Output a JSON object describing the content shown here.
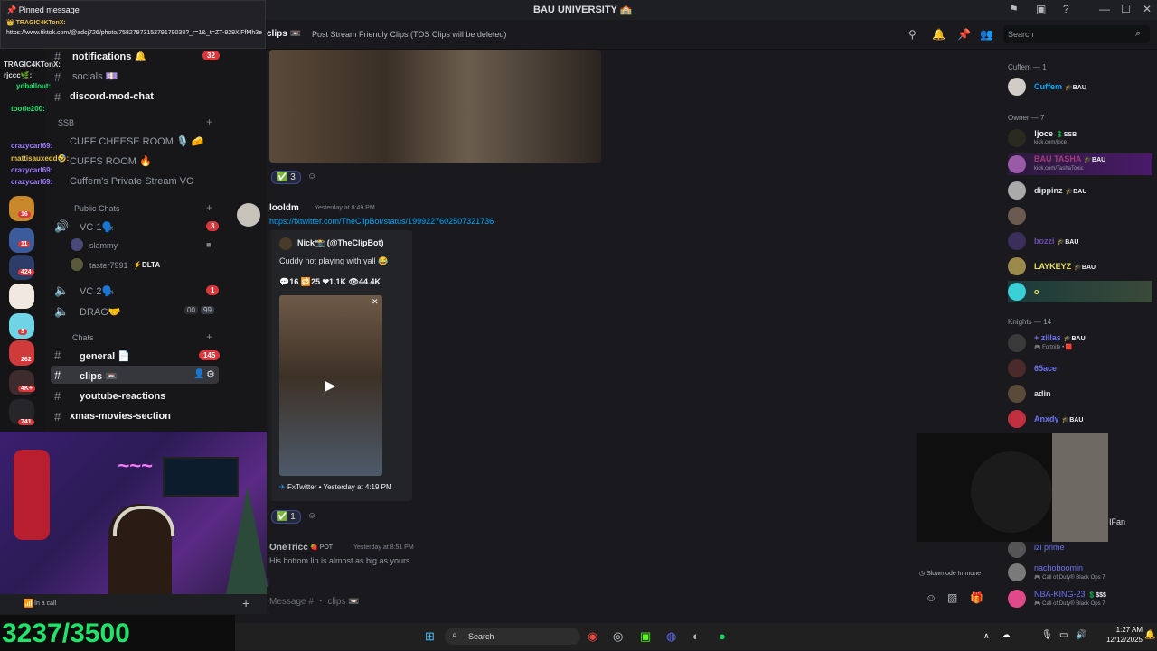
{
  "titlebar": {
    "title": "BAU UNIVERSITY 🏫"
  },
  "pinned": {
    "header": "📌 Pinned message",
    "author": "👑 TRAGIC4KTonX:",
    "link": "https://www.tiktok.com/@adcj726/photo/7582797315279179038?_r=1&_t=ZT-929XiFfMh3e"
  },
  "sidebar": {
    "channels_top": [
      {
        "name": "notifications 🔔",
        "count": "32"
      },
      {
        "name": "socials 💷"
      },
      {
        "name": "discord-mod-chat"
      }
    ],
    "category_ssb": "SSB",
    "voice_top": [
      {
        "name": "CUFF CHEESE ROOM 🎙️ 🧀"
      },
      {
        "name": "CUFFS ROOM 🔥"
      },
      {
        "name": "Cuffem's Private Stream VC"
      }
    ],
    "category_public": "Public Chats",
    "vc1": {
      "name": "VC 1🗣️",
      "count": "3"
    },
    "vc1_users": [
      {
        "name": "slammy"
      },
      {
        "name": "taster7991",
        "badge": "⚡DLTA"
      }
    ],
    "vc2": {
      "name": "VC 2🗣️",
      "count": "1"
    },
    "drag": {
      "name": "DRAG🤝",
      "left": "00",
      "right": "99"
    },
    "category_chats": "Chats",
    "chats": [
      {
        "name": "general 📄",
        "count": "145"
      },
      {
        "name": "clips 📼"
      },
      {
        "name": "youtube-reactions"
      },
      {
        "name": "xmas-movies-section"
      }
    ]
  },
  "chat_overlay": [
    {
      "name": "TRAGIC4KTonX:",
      "color": "#e8c24c"
    },
    {
      "name": "rjccc🌿:",
      "color": "#22e36a"
    },
    {
      "name": "ydballout:",
      "color": "#22e36a"
    },
    {
      "name": "tootie200:",
      "color": "#22e36a"
    },
    {
      "name": "crazycarl69:",
      "color": "#9e7bff"
    },
    {
      "name": "mattisauxedd🤣:",
      "color": "#e8c24c"
    },
    {
      "name": "crazycarl69:",
      "color": "#9e7bff"
    },
    {
      "name": "crazycarl69:",
      "color": "#9e7bff"
    }
  ],
  "server_badges": [
    "16",
    "11",
    "424",
    "3",
    "262",
    "4K+",
    "741"
  ],
  "userbar": {
    "status": "In a call"
  },
  "counter": {
    "value": "3237/3500"
  },
  "header": {
    "channel": "clips 📼",
    "topic": "Post Stream Friendly Clips (TOS Clips will be deleted)",
    "search_placeholder": "Search"
  },
  "messages": {
    "m1": {
      "reaction": "3"
    },
    "m2": {
      "author": "looldm",
      "time": "Yesterday at 8:49 PM",
      "link": "https://fxtwitter.com/TheClipBot/status/1999227602507321736",
      "embed_author": "Nick📸 (@TheClipBot)",
      "embed_text": "Cuddy not playing with yall 😂",
      "stats": {
        "replies": "16",
        "retweets": "25",
        "likes": "1.1K",
        "views": "44.4K"
      },
      "footer": "FxTwitter • Yesterday at 4:19 PM",
      "reaction": "1"
    },
    "m3": {
      "author": "OneTricc",
      "badge": "🍓 POT",
      "time": "Yesterday at 8:51 PM",
      "text": "His bottom lip is almost as big as yours"
    }
  },
  "slowmode": "Slowmode Immune",
  "input": {
    "placeholder": "Message # ・ clips 📼"
  },
  "members": {
    "groups": [
      {
        "title": "Cuffem — 1"
      },
      {
        "title": "Owner — 7"
      },
      {
        "title": "Knights — 14"
      }
    ],
    "list": [
      {
        "name": "Cuffem",
        "tag": "🎓BAU",
        "color": "#00a8fc"
      },
      {
        "name": "!joce",
        "tag": "💲SSB",
        "sub": "kick.com/joce",
        "color": "#f2f3f5"
      },
      {
        "name": "BAU TASHA",
        "tag": "🎓BAU",
        "sub": "kick.com/TashaToxic",
        "color": "#a13d7a"
      },
      {
        "name": "dippinz",
        "tag": "🎓BAU",
        "color": "#dbdee1"
      },
      {
        "name": "",
        "tag": "",
        "color": "#dbdee1"
      },
      {
        "name": "bozzi",
        "tag": "🎓BAU",
        "color": "#6a4bb5"
      },
      {
        "name": "LAYKEYZ",
        "tag": "🎓BAU",
        "color": "#e8e15a"
      },
      {
        "name": "o",
        "tag": "",
        "color": "#e8e15a"
      },
      {
        "name": "+ zillas",
        "tag": "🎓BAU",
        "sub": "🎮 Fortnite • 🟥",
        "color": "#6d73f5"
      },
      {
        "name": "65ace",
        "tag": "",
        "color": "#6d73f5"
      },
      {
        "name": "adin",
        "tag": "",
        "color": "#dbdee1"
      },
      {
        "name": "Anxdy",
        "tag": "🎓BAU",
        "color": "#6d73f5"
      },
      {
        "name": "IFan",
        "tag": "",
        "color": "#dbdee1"
      },
      {
        "name": "izi prime",
        "tag": "",
        "color": "#6d73f5"
      },
      {
        "name": "nachoboomin",
        "tag": "",
        "sub": "🎮 Call of Duty® Black Ops 7",
        "color": "#6d73f5"
      },
      {
        "name": "NBA-KING-23",
        "tag": "💲$$$",
        "sub": "🎮 Call of Duty® Black Ops 7",
        "color": "#6d73f5"
      }
    ]
  },
  "taskbar": {
    "search": "Search",
    "time": "1:27 AM",
    "date": "12/12/2025"
  }
}
